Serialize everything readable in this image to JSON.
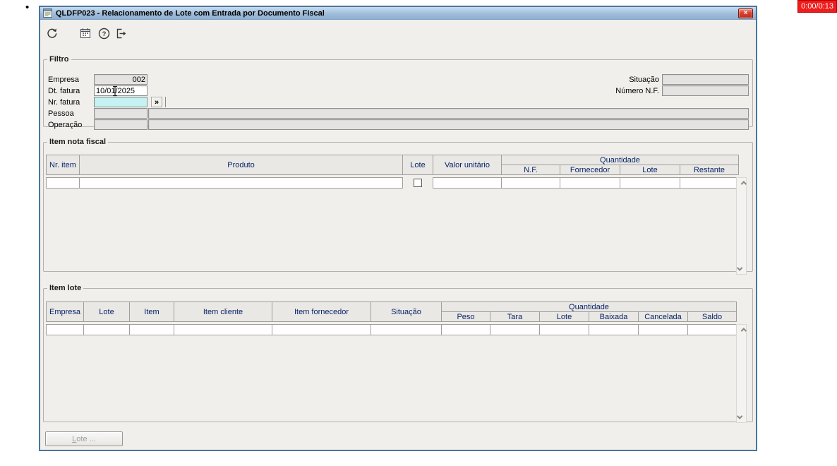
{
  "meta": {
    "bullet": "•",
    "timer_badge": "0:00/0:13"
  },
  "window": {
    "title": "QLDFP023 - Relacionamento de Lote com Entrada por Documento Fiscal",
    "close_glyph": "×"
  },
  "toolbar": {
    "icons": [
      {
        "name": "refresh-icon"
      },
      {
        "name": "calendar-icon"
      },
      {
        "name": "help-icon"
      },
      {
        "name": "exit-icon"
      }
    ]
  },
  "filtro": {
    "legend": "Filtro",
    "empresa": {
      "label": "Empresa",
      "value": "002"
    },
    "dt_fatura": {
      "label": "Dt. fatura",
      "value": "10/01/2025"
    },
    "nr_fatura": {
      "label": "Nr. fatura",
      "value": "",
      "lookup_button": "»"
    },
    "pessoa": {
      "label": "Pessoa",
      "value": "",
      "description": ""
    },
    "operacao": {
      "label": "Operação",
      "value": "",
      "description": ""
    },
    "situacao": {
      "label": "Situação",
      "value": ""
    },
    "numero_nf": {
      "label": "Número N.F.",
      "value": ""
    }
  },
  "item_nota_fiscal": {
    "legend": "Item nota fiscal",
    "quantidade_label": "Quantidade",
    "columns": [
      "Nr. item",
      "Produto",
      "Lote",
      "Valor unitário"
    ],
    "quantidade_columns": [
      "N.F.",
      "Fornecedor",
      "Lote",
      "Restante"
    ],
    "rows": [
      {
        "nr_item": "",
        "produto": "",
        "lote_checked": false,
        "valor_unitario": "",
        "nf": "",
        "fornecedor": "",
        "lote": "",
        "restante": ""
      }
    ]
  },
  "item_lote": {
    "legend": "Item lote",
    "quantidade_label": "Quantidade",
    "columns": [
      "Empresa",
      "Lote",
      "Item",
      "Item cliente",
      "Item fornecedor",
      "Situação"
    ],
    "quantidade_columns": [
      "Peso",
      "Tara",
      "Lote",
      "Baixada",
      "Cancelada",
      "Saldo"
    ],
    "rows": [
      {
        "empresa": "",
        "lote": "",
        "item": "",
        "item_cliente": "",
        "item_fornecedor": "",
        "situacao": "",
        "peso": "",
        "tara": "",
        "lote_q": "",
        "baixada": "",
        "cancelada": "",
        "saldo": ""
      }
    ]
  },
  "footer": {
    "lote_button_accel": "L",
    "lote_button_rest": "ote ..."
  },
  "colors": {
    "titlebar_top": "#cadcee",
    "titlebar_bottom": "#8fb0d2",
    "window_border": "#49759c",
    "focus_field": "#c5f2f2",
    "header_text": "#0a246a",
    "close_button": "#d8402f",
    "timer_badge_bg": "#ee1c1c"
  }
}
